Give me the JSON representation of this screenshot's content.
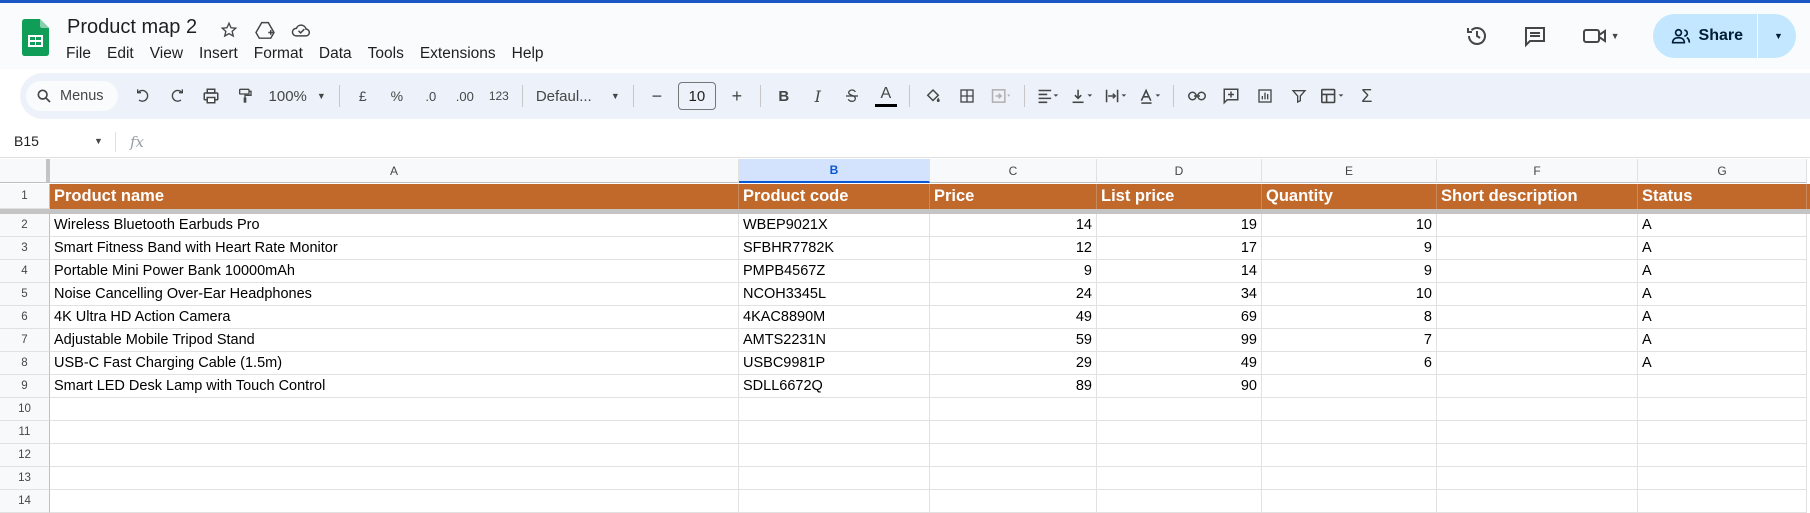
{
  "title_bar": {
    "doc_title": "Product map 2",
    "menu": [
      "File",
      "Edit",
      "View",
      "Insert",
      "Format",
      "Data",
      "Tools",
      "Extensions",
      "Help"
    ],
    "share_label": "Share"
  },
  "toolbar": {
    "search_label": "Menus",
    "zoom": "100%",
    "currency": "£",
    "percent": "%",
    "dec_decrease": ".0",
    "dec_increase": ".00",
    "number_format": "123",
    "font_name": "Defaul...",
    "font_size": "10",
    "bold": "B",
    "italic": "I",
    "text_color_glyph": "A"
  },
  "formula_bar": {
    "cell_ref": "B15",
    "fx": "fx"
  },
  "columns": [
    "A",
    "B",
    "C",
    "D",
    "E",
    "F",
    "G"
  ],
  "selected_column": "B",
  "rows": [
    "1",
    "2",
    "3",
    "4",
    "5",
    "6",
    "7",
    "8",
    "9",
    "10",
    "11",
    "12",
    "13",
    "14"
  ],
  "header_row": [
    "Product name",
    "Product code",
    "Price",
    "List price",
    "Quantity",
    "Short description",
    "Status"
  ],
  "data_rows": [
    [
      "Wireless Bluetooth Earbuds Pro",
      "WBEP9021X",
      "14",
      "19",
      "10",
      "",
      "A"
    ],
    [
      "Smart Fitness Band with Heart Rate Monitor",
      "SFBHR7782K",
      "12",
      "17",
      "9",
      "",
      "A"
    ],
    [
      "Portable Mini Power Bank 10000mAh",
      "PMPB4567Z",
      "9",
      "14",
      "9",
      "",
      "A"
    ],
    [
      "Noise Cancelling Over-Ear Headphones",
      "NCOH3345L",
      "24",
      "34",
      "10",
      "",
      "A"
    ],
    [
      "4K Ultra HD Action Camera",
      "4KAC8890M",
      "49",
      "69",
      "8",
      "",
      "A"
    ],
    [
      "Adjustable Mobile Tripod Stand",
      "AMTS2231N",
      "59",
      "99",
      "7",
      "",
      "A"
    ],
    [
      "USB-C Fast Charging Cable (1.5m)",
      "USBC9981P",
      "29",
      "49",
      "6",
      "",
      "A"
    ],
    [
      "Smart LED Desk Lamp with Touch Control",
      "SDLL6672Q",
      "89",
      "90",
      "",
      "",
      ""
    ]
  ],
  "colors": {
    "header_fill": "#c0692b",
    "accent": "#0b57d0",
    "share_bg": "#c2e7ff"
  }
}
